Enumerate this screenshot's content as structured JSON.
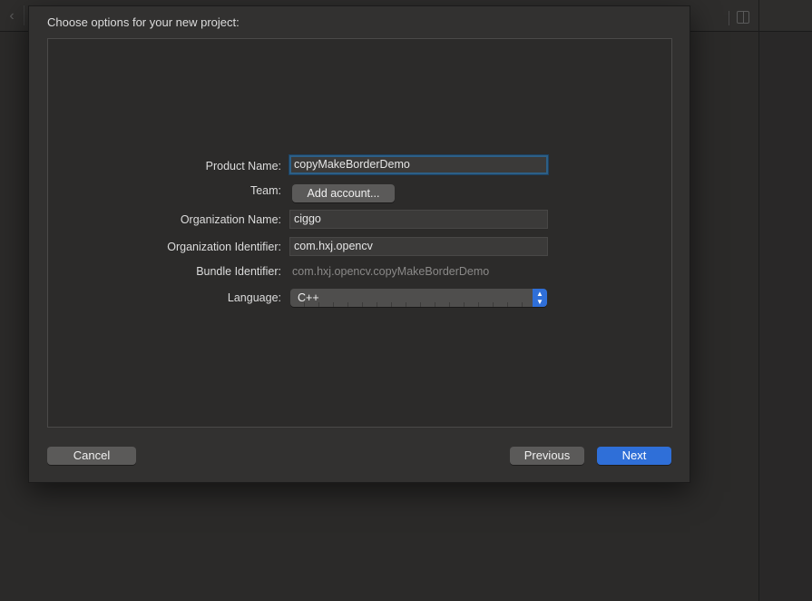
{
  "dialog": {
    "title": "Choose options for your new project:"
  },
  "form": {
    "product_name": {
      "label": "Product Name:",
      "value": "copyMakeBorderDemo"
    },
    "team": {
      "label": "Team:",
      "button_label": "Add account..."
    },
    "organization_name": {
      "label": "Organization Name:",
      "value": "ciggo"
    },
    "organization_identifier": {
      "label": "Organization Identifier:",
      "value": "com.hxj.opencv"
    },
    "bundle_identifier": {
      "label": "Bundle Identifier:",
      "value": "com.hxj.opencv.copyMakeBorderDemo"
    },
    "language": {
      "label": "Language:",
      "selected": "C++"
    }
  },
  "footer": {
    "cancel_label": "Cancel",
    "previous_label": "Previous",
    "next_label": "Next"
  },
  "icons": {
    "back": "chevron-left-icon",
    "inspector": "inspector-toggle-icon",
    "stepper": "up-down-chevron-icon"
  },
  "colors": {
    "accent": "#2f6fd8",
    "focus_ring": "#2d5f86",
    "sheet_background": "#323130",
    "window_background": "#2b2a29"
  }
}
